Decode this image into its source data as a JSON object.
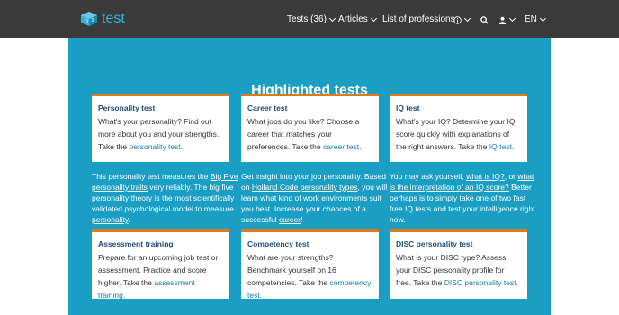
{
  "brand": {
    "name": "test"
  },
  "nav": {
    "tests_label": "Tests (36)",
    "articles_label": "Articles",
    "professions_label": "List of professions",
    "lang_label": "EN"
  },
  "main": {
    "heading": "Highlighted tests"
  },
  "cards": [
    {
      "title": "Personality test",
      "text": "What's your personality? Find out more about you and your strengths. Take the ",
      "link": "personality test",
      "after": "."
    },
    {
      "title": "Career test",
      "text": "What jobs do you like? Choose a career that matches your preferences. Take the ",
      "link": "career test",
      "after": "."
    },
    {
      "title": "IQ test",
      "text": "What's your IQ? Determine your IQ score quickly with explanations of the right answers. Take the ",
      "link": "IQ test",
      "after": "."
    },
    {
      "title": "Assessment training",
      "text": "Prepare for an upcoming job test or assessment. Practice and score higher. Take the ",
      "link": "assessment training",
      "after": "."
    },
    {
      "title": "Competency test",
      "text": "What are your strengths? Benchmark yourself on 16 competencies. Take the ",
      "link": "competency test",
      "after": "."
    },
    {
      "title": "DISC personality test",
      "text": "What is your DISC type? Assess your DISC personality profile for free. Take the ",
      "link": "DISC personality test",
      "after": "."
    }
  ],
  "descriptions": [
    {
      "t1": "This personality test measures the ",
      "l1": "Big Five personality traits",
      "t2": " very reliably. The big five personality theory is the most scientifically validated psychological model to measure ",
      "l2": "personality",
      "t3": "."
    },
    {
      "t1": "Get insight into your job personality. Based on ",
      "l1": "Holland Code personality types",
      "t2": ", you will learn what kind of work environments suit you best. Increase your chances of a successful ",
      "l2": "career",
      "t3": "!"
    },
    {
      "t1": "You may ask yourself, ",
      "l1": "what is IQ?",
      "t2": ", or ",
      "l2": "what is the interpretation of an IQ score?",
      "t3": " Better perhaps is to simply take one of two fast free IQ tests and test your intelligence right now."
    }
  ],
  "icons": {
    "logo": "brain-cube-logo-icon",
    "info": "info-icon",
    "search": "search-icon",
    "user": "user-icon"
  },
  "colors": {
    "navbar": "#3a3a3a",
    "panel": "#1a9ec4",
    "card_accent": "#e07a14",
    "brand": "#36b0d8"
  }
}
